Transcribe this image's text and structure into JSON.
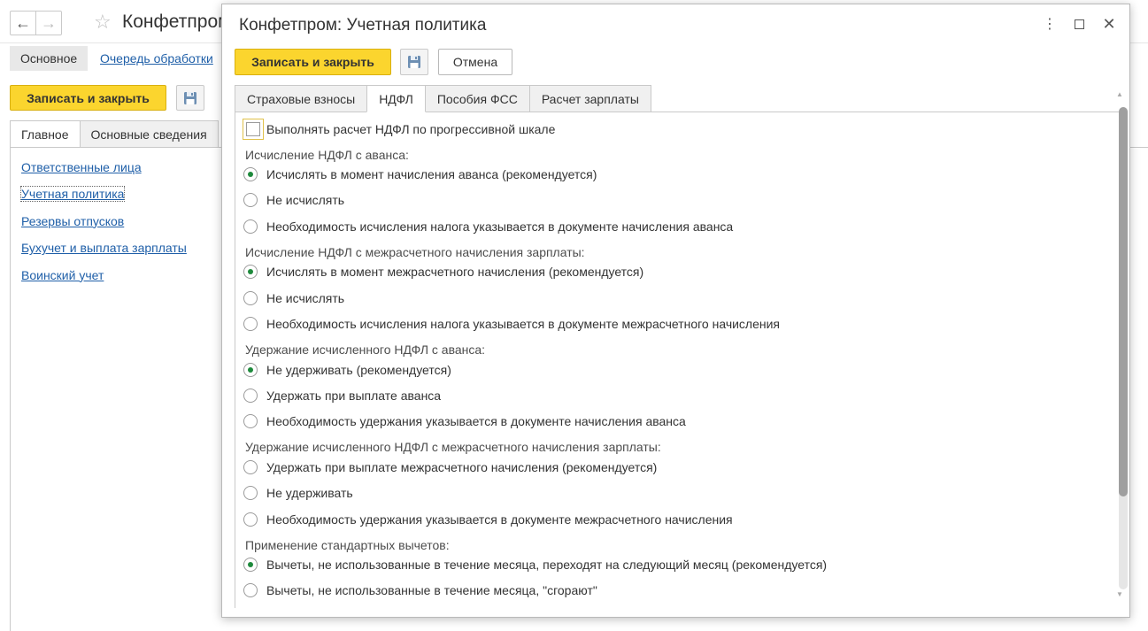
{
  "background": {
    "nav": {
      "back_icon": "←",
      "forward_icon": "→"
    },
    "star_icon": "☆",
    "title": "Конфетпром",
    "panel": {
      "tab_main": "Основное",
      "link_queue": "Очередь обработки"
    },
    "toolbar": {
      "save_close": "Записать и закрыть"
    },
    "tabs": [
      "Главное",
      "Основные сведения"
    ],
    "links": [
      "Ответственные лица",
      "Учетная политика",
      "Резервы отпусков",
      "Бухучет и выплата зарплаты",
      "Воинский учет"
    ]
  },
  "dialog": {
    "title": "Конфетпром: Учетная политика",
    "controls": {
      "more": "⋮",
      "close": "✕"
    },
    "toolbar": {
      "save_close": "Записать и закрыть",
      "cancel": "Отмена"
    },
    "tabs": [
      "Страховые взносы",
      "НДФЛ",
      "Пособия ФСС",
      "Расчет зарплаты"
    ],
    "active_tab": "НДФЛ",
    "progressive_scale": {
      "label": "Выполнять расчет НДФЛ по прогрессивной шкале",
      "checked": false
    },
    "groups": [
      {
        "title": "Исчисление НДФЛ с аванса:",
        "options": [
          {
            "label": "Исчислять в момент начисления аванса (рекомендуется)",
            "selected": true
          },
          {
            "label": "Не исчислять",
            "selected": false
          },
          {
            "label": "Необходимость исчисления налога указывается в документе начисления аванса",
            "selected": false
          }
        ]
      },
      {
        "title": "Исчисление НДФЛ с межрасчетного начисления зарплаты:",
        "options": [
          {
            "label": "Исчислять в момент межрасчетного начисления (рекомендуется)",
            "selected": true
          },
          {
            "label": "Не исчислять",
            "selected": false
          },
          {
            "label": "Необходимость исчисления налога указывается в документе межрасчетного начисления",
            "selected": false
          }
        ]
      },
      {
        "title": "Удержание исчисленного НДФЛ с аванса:",
        "options": [
          {
            "label": "Не удерживать (рекомендуется)",
            "selected": true
          },
          {
            "label": "Удержать при выплате аванса",
            "selected": false
          },
          {
            "label": "Необходимость удержания указывается в документе начисления аванса",
            "selected": false
          }
        ]
      },
      {
        "title": "Удержание исчисленного НДФЛ с межрасчетного начисления зарплаты:",
        "options": [
          {
            "label": "Удержать при выплате межрасчетного начисления (рекомендуется)",
            "selected": false
          },
          {
            "label": "Не удерживать",
            "selected": false
          },
          {
            "label": "Необходимость удержания указывается в документе межрасчетного начисления",
            "selected": false
          }
        ]
      },
      {
        "title": "Применение стандартных вычетов:",
        "options": [
          {
            "label": "Вычеты, не использованные в течение месяца, переходят на следующий месяц (рекомендуется)",
            "selected": true
          },
          {
            "label": "Вычеты, не использованные в течение месяца, \"сгорают\"",
            "selected": false
          }
        ]
      }
    ]
  },
  "colors": {
    "accent_yellow": "#fbd52e",
    "link_blue": "#1f5fa8",
    "radio_green": "#1e8a3c"
  }
}
